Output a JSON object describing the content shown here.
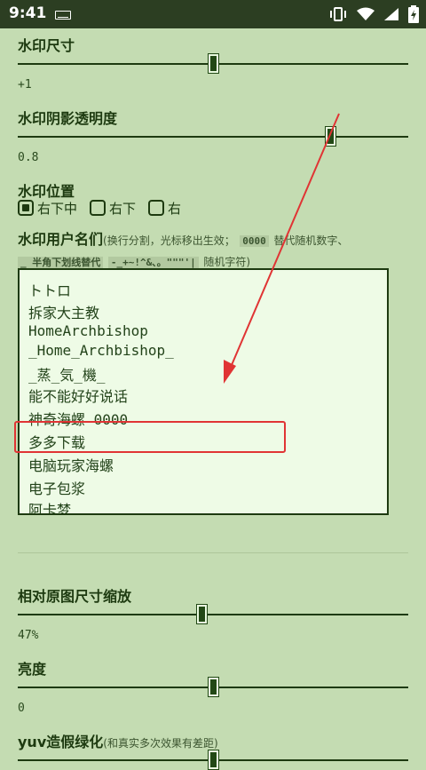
{
  "status": {
    "time": "9:41"
  },
  "watermark_size": {
    "label": "水印尺寸",
    "value": "+1",
    "level": 0.5
  },
  "shadow_opacity": {
    "label": "水印阴影透明度",
    "value": "0.8",
    "level": 0.8
  },
  "position": {
    "label": "水印位置",
    "options": [
      {
        "label": "右下中",
        "checked": true
      },
      {
        "label": "右下",
        "checked": false
      },
      {
        "label": "右",
        "checked": false
      }
    ]
  },
  "usernames": {
    "label": "水印用户名们",
    "hint_1": "(换行分割，光标移出生效；",
    "code_1": "0000",
    "hint_2": "替代随机数字、",
    "hint_3": "_ 半角下划线替代",
    "code_2": "-_+~!^&、。\"\"\"'|",
    "hint_4": "随机字符)",
    "names": [
      "トトロ",
      "拆家大主教",
      "HomeArchbishop",
      "_Home_Archbishop_",
      "_蒸_気_機_",
      "能不能好好说话",
      "神奇海螺 0000",
      "多多下载",
      "电脑玩家海螺",
      "电子包浆",
      "阿卡梦"
    ]
  },
  "scale": {
    "label": "相对原图尺寸缩放",
    "value": "47%",
    "level": 0.47
  },
  "brightness": {
    "label": "亮度",
    "value": "0",
    "level": 0.5
  },
  "yuv": {
    "label": "yuv造假绿化",
    "hint": "(和真实多次效果有差距)"
  },
  "colors": {
    "background": "#c4dcb2",
    "accent": "#224815",
    "highlight": "#e03434"
  }
}
